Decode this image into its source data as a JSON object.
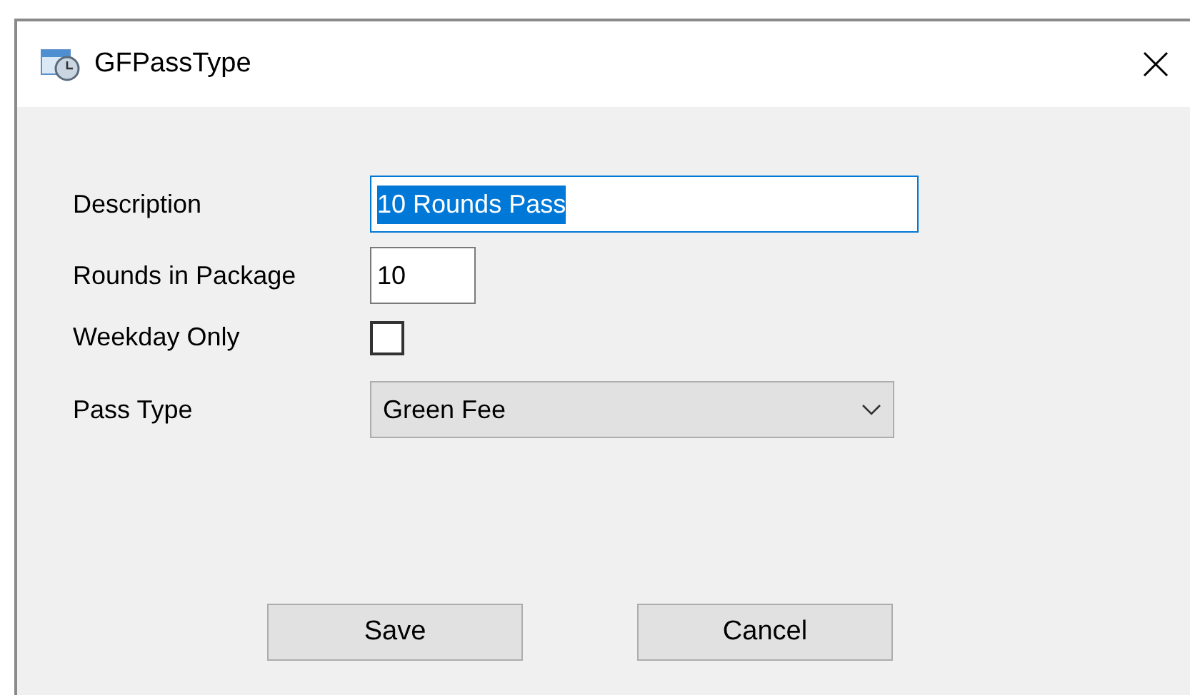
{
  "window": {
    "title": "GFPassType"
  },
  "fields": [
    {
      "kind": "text",
      "label": "Description",
      "value": "10 Rounds Pass",
      "text_selected": true,
      "focused": true
    },
    {
      "kind": "text",
      "label": "Rounds in Package",
      "value": "10",
      "text_selected": false,
      "focused": false
    },
    {
      "kind": "checkbox",
      "label": "Weekday Only",
      "checked": false
    },
    {
      "kind": "select",
      "label": "Pass Type",
      "value": "Green Fee"
    }
  ],
  "buttons": [
    "Save",
    "Cancel"
  ]
}
